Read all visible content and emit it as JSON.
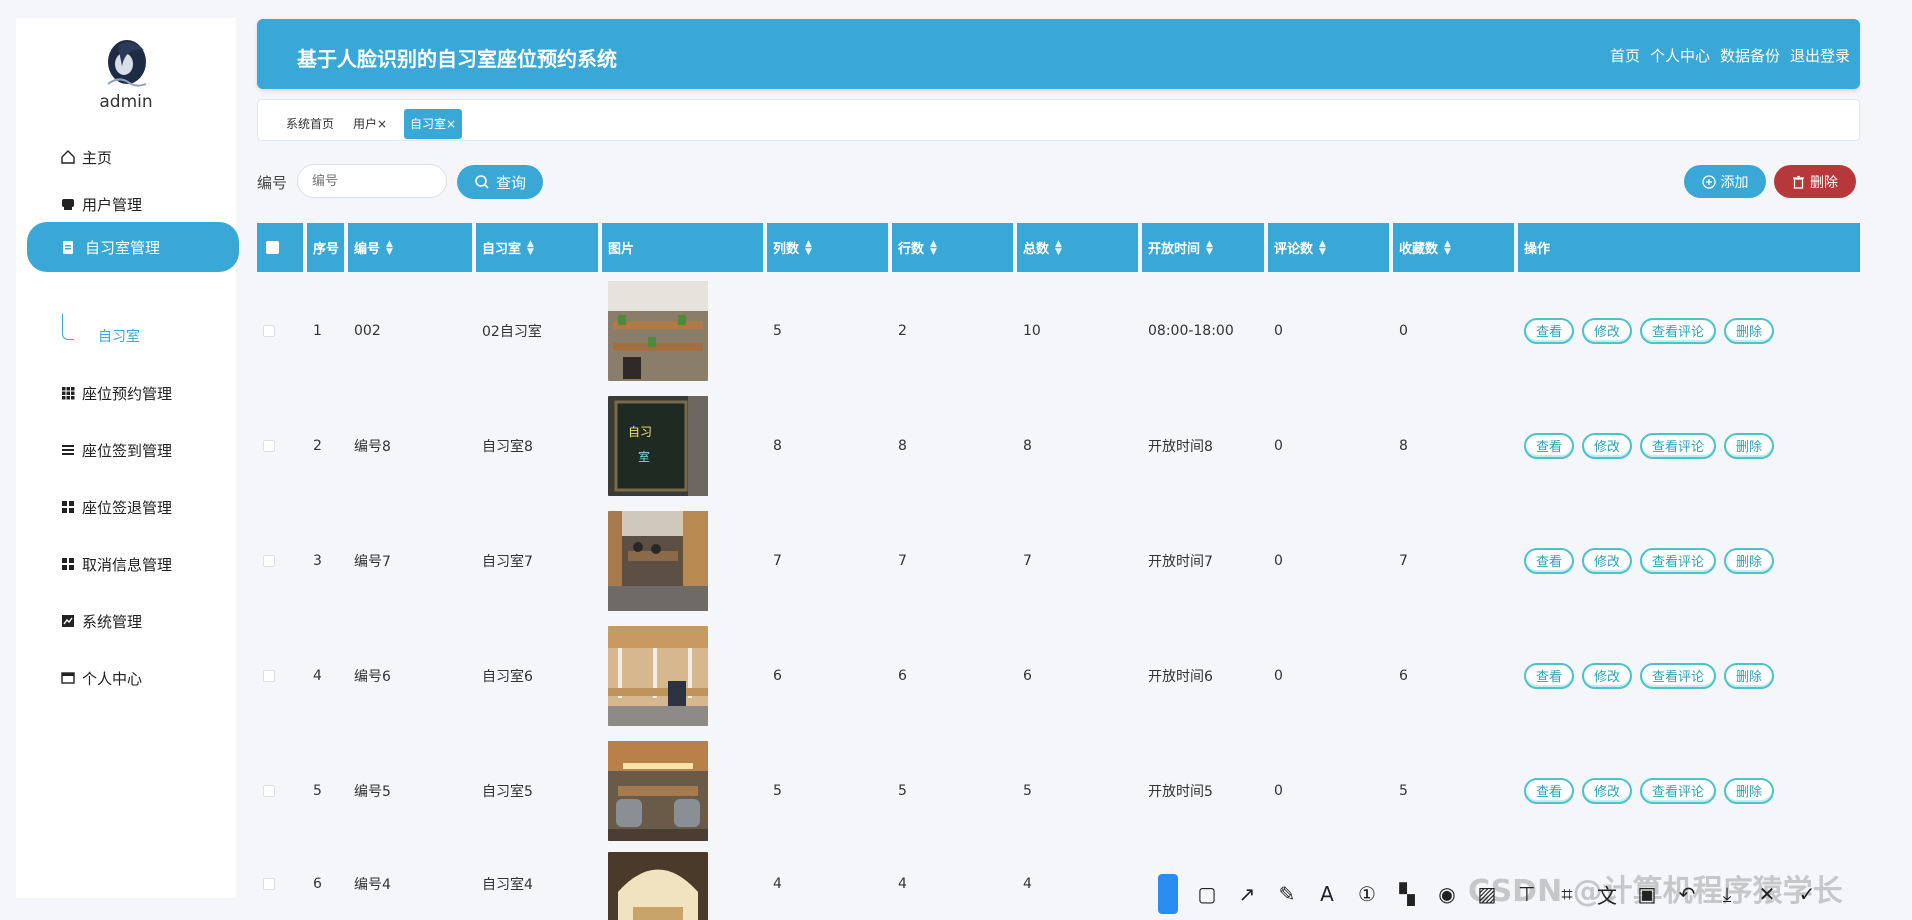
{
  "sidebar": {
    "admin_name": "admin",
    "items": [
      {
        "label": "主页",
        "icon": "home-icon"
      },
      {
        "label": "用户管理",
        "icon": "user-icon"
      },
      {
        "label": "自习室管理",
        "icon": "clipboard-icon",
        "active": true
      },
      {
        "label": "座位预约管理",
        "icon": "grid-icon"
      },
      {
        "label": "座位签到管理",
        "icon": "list-icon"
      },
      {
        "label": "座位签退管理",
        "icon": "squares-icon"
      },
      {
        "label": "取消信息管理",
        "icon": "squares-icon"
      },
      {
        "label": "系统管理",
        "icon": "chart-icon"
      },
      {
        "label": "个人中心",
        "icon": "window-icon"
      }
    ],
    "submenu_label": "自习室"
  },
  "header": {
    "title": "基于人脸识别的自习室座位预约系统",
    "nav": [
      "首页",
      "个人中心",
      "数据备份",
      "退出登录"
    ]
  },
  "tabs": [
    {
      "label": "系统首页"
    },
    {
      "label": "用户×"
    },
    {
      "label": "自习室×",
      "active": true
    }
  ],
  "search": {
    "label": "编号",
    "placeholder": "编号",
    "button_label": "查询"
  },
  "actions": {
    "add_label": "添加",
    "delete_label": "删除"
  },
  "table": {
    "columns": [
      "序号",
      "编号",
      "自习室",
      "图片",
      "列数",
      "行数",
      "总数",
      "开放时间",
      "评论数",
      "收藏数",
      "操作"
    ],
    "sortable": [
      false,
      true,
      true,
      false,
      true,
      true,
      true,
      true,
      true,
      true,
      false
    ],
    "rows": [
      {
        "index": "1",
        "code": "002",
        "room": "02自习室",
        "cols": "5",
        "rows": "2",
        "total": "10",
        "open": "08:00-18:00",
        "comments": "0",
        "favorites": "0"
      },
      {
        "index": "2",
        "code": "编号8",
        "room": "自习室8",
        "cols": "8",
        "rows": "8",
        "total": "8",
        "open": "开放时间8",
        "comments": "0",
        "favorites": "8"
      },
      {
        "index": "3",
        "code": "编号7",
        "room": "自习室7",
        "cols": "7",
        "rows": "7",
        "total": "7",
        "open": "开放时间7",
        "comments": "0",
        "favorites": "7"
      },
      {
        "index": "4",
        "code": "编号6",
        "room": "自习室6",
        "cols": "6",
        "rows": "6",
        "total": "6",
        "open": "开放时间6",
        "comments": "0",
        "favorites": "6"
      },
      {
        "index": "5",
        "code": "编号5",
        "room": "自习室5",
        "cols": "5",
        "rows": "5",
        "total": "5",
        "open": "开放时间5",
        "comments": "0",
        "favorites": "5"
      },
      {
        "index": "6",
        "code": "编号4",
        "room": "自习室4",
        "cols": "4",
        "rows": "4",
        "total": "4",
        "open": "",
        "comments": "",
        "favorites": ""
      }
    ],
    "row_actions": [
      "查看",
      "修改",
      "查看评论",
      "删除"
    ]
  },
  "watermark": "CSDN @计算机程序猿学长",
  "colors": {
    "primary": "#3aa8d6",
    "danger": "#b6383a",
    "op_border": "#4cc3c8"
  }
}
